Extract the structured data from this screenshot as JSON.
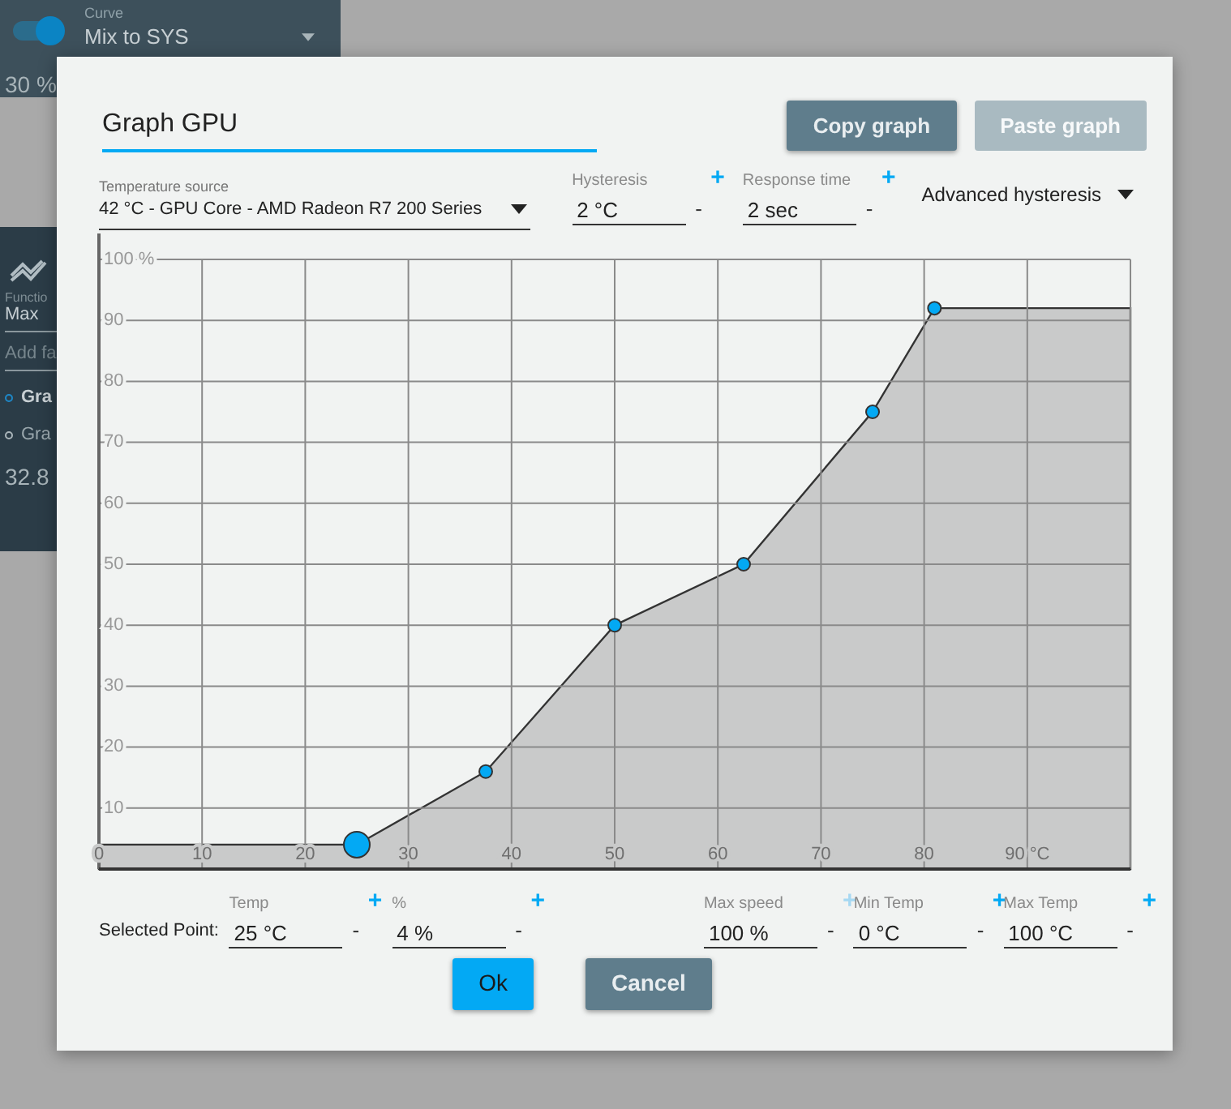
{
  "background": {
    "curve_panel": {
      "toggle_on": true,
      "label": "Curve",
      "value": "Mix to SYS",
      "reading": "30 %"
    },
    "function_panel": {
      "label": "Functio",
      "value": "Max",
      "placeholder": "Add fa",
      "items": [
        {
          "label": "Gra",
          "selected": true
        },
        {
          "label": "Gra",
          "selected": false
        }
      ],
      "reading": "32.8"
    }
  },
  "dialog": {
    "name_value": "Graph GPU",
    "buttons": [
      {
        "label": "Copy graph",
        "disabled": false
      },
      {
        "label": "Paste graph",
        "disabled": true
      }
    ],
    "temperature_source": {
      "label": "Temperature source",
      "value": "42 °C - GPU Core - AMD Radeon R7 200 Series"
    },
    "settings": [
      {
        "label": "Hysteresis",
        "value": "2 °C",
        "plus": "+",
        "minus": "-",
        "plus_disabled": false
      },
      {
        "label": "Response time",
        "value": "2 sec",
        "plus": "+",
        "minus": "-",
        "plus_disabled": false
      }
    ],
    "advanced": {
      "label": "Advanced hysteresis"
    },
    "graph": {
      "points": [
        {
          "selected": true
        },
        {
          "selected": false
        },
        {
          "selected": false
        },
        {
          "selected": false
        },
        {
          "selected": false
        },
        {
          "selected": false
        }
      ],
      "chart_data": {
        "type": "area",
        "x": [
          0,
          25,
          37.5,
          50,
          62.5,
          75,
          81,
          100
        ],
        "series": [
          {
            "color": "#c9caca",
            "values": [
              4,
              4,
              16,
              40,
              50,
              75,
              92,
              92
            ]
          }
        ],
        "xlim": [
          0,
          100
        ],
        "ylim": [
          0,
          100
        ],
        "grid": true,
        "xticks": [
          {
            "value": 0,
            "label": "0"
          },
          {
            "value": 10,
            "label": "10"
          },
          {
            "value": 20,
            "label": "20"
          },
          {
            "value": 30,
            "label": "30"
          },
          {
            "value": 40,
            "label": "40"
          },
          {
            "value": 50,
            "label": "50"
          },
          {
            "value": 60,
            "label": "60"
          },
          {
            "value": 70,
            "label": "70"
          },
          {
            "value": 80,
            "label": "80"
          },
          {
            "value": 90,
            "label": "90 °C"
          }
        ],
        "yticks": [
          {
            "value": 10,
            "label": "10"
          },
          {
            "value": 20,
            "label": "20"
          },
          {
            "value": 30,
            "label": "30"
          },
          {
            "value": 40,
            "label": "40"
          },
          {
            "value": 50,
            "label": "50"
          },
          {
            "value": 60,
            "label": "60"
          },
          {
            "value": 70,
            "label": "70"
          },
          {
            "value": 80,
            "label": "80"
          },
          {
            "value": 90,
            "label": "90"
          },
          {
            "value": 100,
            "label": "100 %"
          }
        ]
      }
    },
    "selected_point": {
      "label": "Selected Point:",
      "fields": [
        {
          "label": "Temp",
          "value": "25 °C",
          "plus": "+",
          "minus": "-",
          "plus_disabled": false
        },
        {
          "label": "%",
          "value": "4 %",
          "plus": "+",
          "minus": "-",
          "plus_disabled": false
        }
      ]
    },
    "limits": [
      {
        "label": "Max speed",
        "value": "100 %",
        "plus": "+",
        "minus": "-",
        "plus_disabled": true
      },
      {
        "label": "Min Temp",
        "value": "0 °C",
        "plus": "+",
        "minus": "-",
        "plus_disabled": false
      },
      {
        "label": "Max Temp",
        "value": "100 °C",
        "plus": "+",
        "minus": "-",
        "plus_disabled": false
      }
    ],
    "actions": [
      {
        "label": "Ok",
        "kind": "primary"
      },
      {
        "label": "Cancel",
        "kind": "secondary"
      }
    ]
  }
}
